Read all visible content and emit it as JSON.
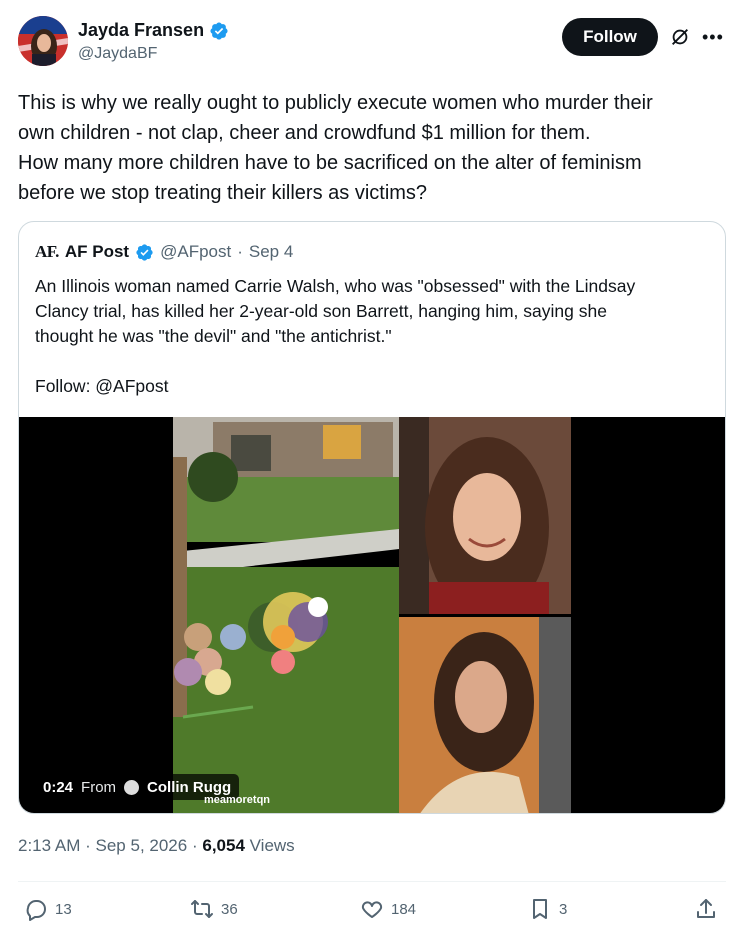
{
  "author": {
    "display_name": "Jayda Fransen",
    "handle": "@JaydaBF",
    "verified": true,
    "verified_color": "#1d9bf0"
  },
  "follow_label": "Follow",
  "tweet_lines": [
    "This is why we really ought to publicly execute women who murder their",
    "own children - not clap, cheer and crowdfund $1 million for them.",
    "How many more children have to be sacrificed on the alter of feminism",
    "before we stop treating their killers as victims?"
  ],
  "quote": {
    "logo": "AF.",
    "name": "AF Post",
    "handle": "@AFpost",
    "separator": "·",
    "date": "Sep 4",
    "text_lines": [
      "An Illinois woman named Carrie Walsh, who was \"obsessed\" with the Lindsay",
      "Clancy trial, has killed her 2-year-old son Barrett, hanging him, saying she",
      "thought he was \"the devil\" and \"the antichrist.\""
    ],
    "follow_line": "Follow: @AFpost",
    "media": {
      "duration": "0:24",
      "from_label": "From",
      "source_name": "Collin Rugg",
      "watermark": "meamoretqn"
    }
  },
  "meta": {
    "time": "2:13 AM",
    "date": "Sep 5, 2026",
    "views_count": "6,054",
    "views_label": "Views"
  },
  "actions": {
    "replies": "13",
    "reposts": "36",
    "likes": "184",
    "bookmarks": "3"
  },
  "icons": [
    "reply-icon",
    "repost-icon",
    "like-icon",
    "bookmark-icon",
    "share-icon",
    "grok-icon",
    "more-icon",
    "verified-badge-icon"
  ]
}
